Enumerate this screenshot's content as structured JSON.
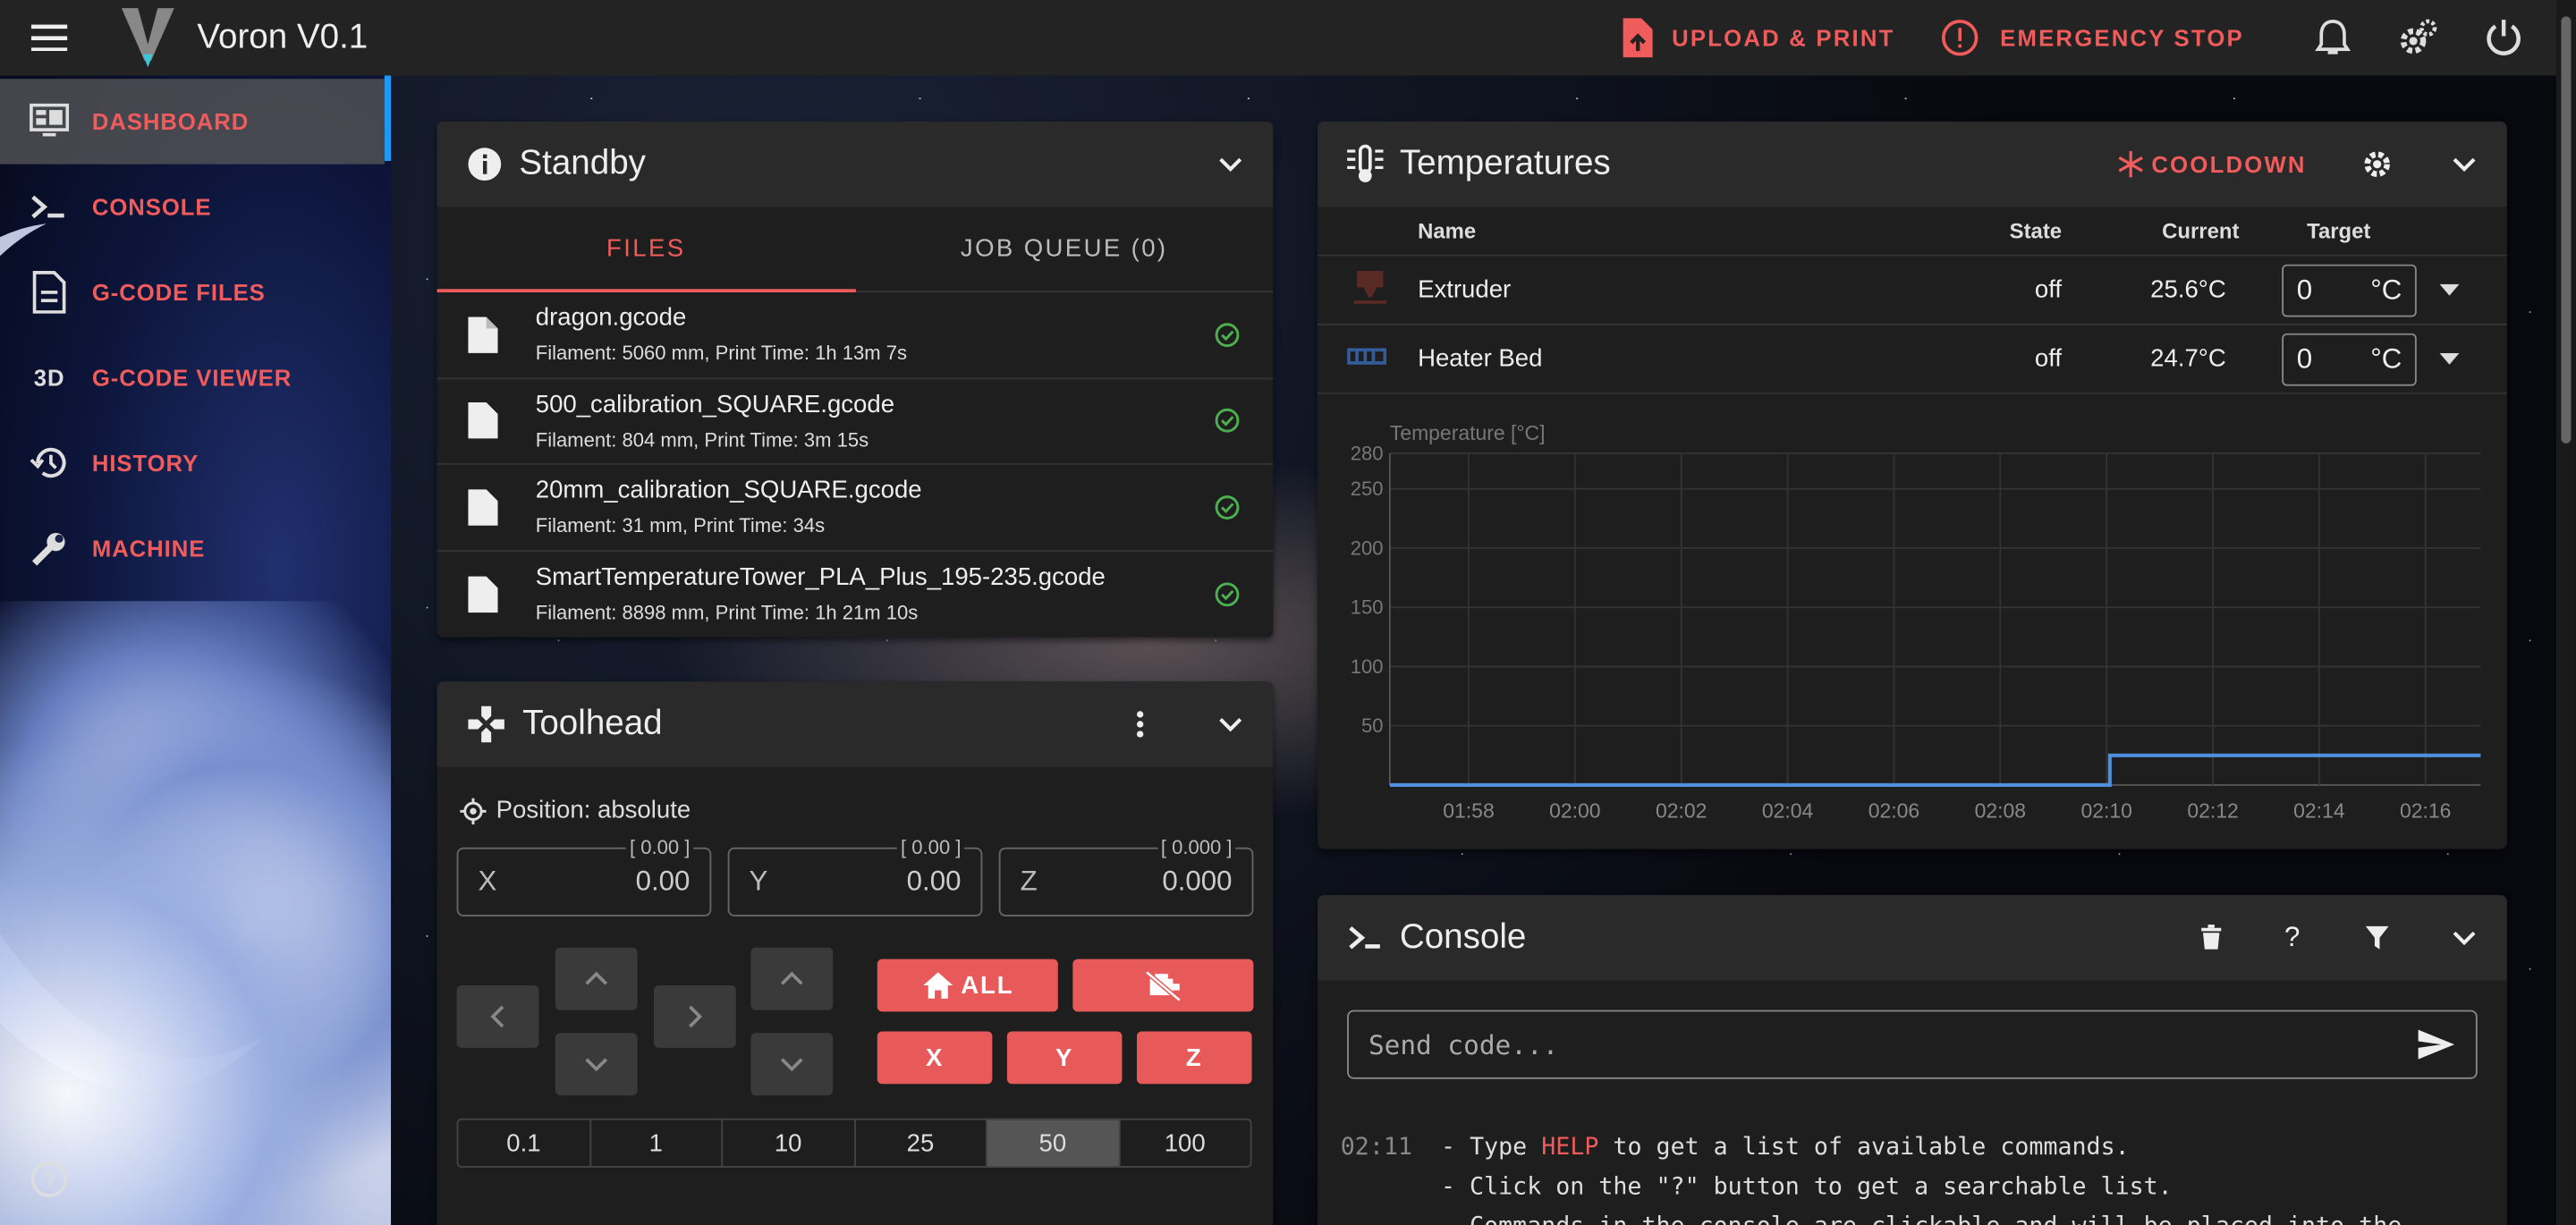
{
  "app": {
    "title": "Voron V0.1"
  },
  "topbar": {
    "upload_label": "UPLOAD & PRINT",
    "estop_label": "EMERGENCY STOP"
  },
  "nav": {
    "items": [
      {
        "label": "DASHBOARD",
        "icon": "monitor-dashboard-icon"
      },
      {
        "label": "CONSOLE",
        "icon": "console-icon"
      },
      {
        "label": "G-CODE FILES",
        "icon": "file-document-icon"
      },
      {
        "label": "G-CODE VIEWER",
        "icon": "3d-icon"
      },
      {
        "label": "HISTORY",
        "icon": "history-icon"
      },
      {
        "label": "MACHINE",
        "icon": "wrench-icon"
      }
    ]
  },
  "status": {
    "title": "Standby",
    "tabs": [
      "FILES",
      "JOB QUEUE (0)"
    ],
    "files": [
      {
        "name": "dragon.gcode",
        "meta": "Filament: 5060 mm, Print Time: 1h 13m 7s"
      },
      {
        "name": "500_calibration_SQUARE.gcode",
        "meta": "Filament: 804 mm, Print Time: 3m 15s"
      },
      {
        "name": "20mm_calibration_SQUARE.gcode",
        "meta": "Filament: 31 mm, Print Time: 34s"
      },
      {
        "name": "SmartTemperatureTower_PLA_Plus_195-235.gcode",
        "meta": "Filament: 8898 mm, Print Time: 1h 21m 10s"
      }
    ]
  },
  "toolhead": {
    "title": "Toolhead",
    "position_label": "Position: absolute",
    "axes": [
      {
        "label": "X",
        "value": "0.00",
        "limit": "[ 0.00 ]"
      },
      {
        "label": "Y",
        "value": "0.00",
        "limit": "[ 0.00 ]"
      },
      {
        "label": "Z",
        "value": "0.000",
        "limit": "[ 0.000 ]"
      }
    ],
    "home_all": "ALL",
    "home_x": "X",
    "home_y": "Y",
    "home_z": "Z",
    "steps": [
      "0.1",
      "1",
      "10",
      "25",
      "50",
      "100"
    ],
    "selected_step": "50"
  },
  "temperatures": {
    "title": "Temperatures",
    "cooldown": "COOLDOWN",
    "headers": {
      "name": "Name",
      "state": "State",
      "current": "Current",
      "target": "Target"
    },
    "rows": [
      {
        "name": "Extruder",
        "state": "off",
        "current": "25.6°C",
        "target": "0",
        "unit": "°C"
      },
      {
        "name": "Heater Bed",
        "state": "off",
        "current": "24.7°C",
        "target": "0",
        "unit": "°C"
      }
    ]
  },
  "chart_data": {
    "type": "line",
    "ylabel": "Temperature [°C]",
    "x": [
      "01:57",
      "01:58",
      "02:00",
      "02:02",
      "02:04",
      "02:06",
      "02:08",
      "02:10",
      "02:10",
      "02:12",
      "02:14",
      "02:16",
      "02:17"
    ],
    "x_ticks": [
      "01:58",
      "02:00",
      "02:02",
      "02:04",
      "02:06",
      "02:08",
      "02:10",
      "02:12",
      "02:14",
      "02:16"
    ],
    "y_ticks": [
      50,
      100,
      150,
      200,
      250,
      280
    ],
    "ylim": [
      0,
      280
    ],
    "series": [
      {
        "values": [
          0,
          0,
          0,
          0,
          0,
          0,
          0,
          0,
          25,
          25,
          25,
          25,
          25
        ],
        "color": "#4f8fe0"
      }
    ],
    "grid": true
  },
  "console": {
    "title": "Console",
    "placeholder": "Send code...",
    "lines": [
      {
        "time": "02:11",
        "parts": [
          "- Type ",
          "HELP",
          " to get a list of available commands."
        ]
      },
      {
        "time": "",
        "parts": [
          "- Click on the \"?\" button to get a searchable list."
        ]
      },
      {
        "time": "",
        "parts": [
          "- Commands in the console are clickable and will be placed into the"
        ]
      }
    ]
  },
  "colors": {
    "accent": "#f05b5b",
    "active_nav_edge": "#2196f3",
    "ok": "#4caf50"
  }
}
